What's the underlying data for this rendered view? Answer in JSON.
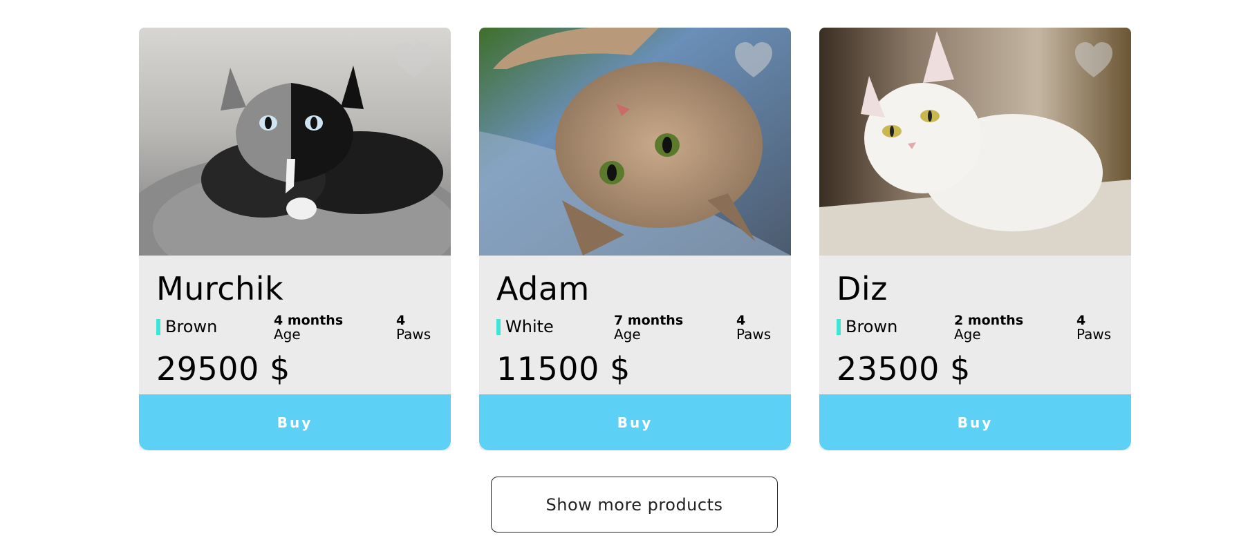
{
  "products": [
    {
      "name": "Murchik",
      "color": "Brown",
      "age_value": "4 months",
      "age_label": "Age",
      "paws_value": "4",
      "paws_label": "Paws",
      "price": "29500 $",
      "buy_label": "Buy",
      "photo": "cat-photo-gray-black-split-face"
    },
    {
      "name": "Adam",
      "color": "White",
      "age_value": "7 months",
      "age_label": "Age",
      "paws_value": "4",
      "paws_label": "Paws",
      "price": "11500 $",
      "buy_label": "Buy",
      "photo": "cat-photo-tabby-lying-upside-down"
    },
    {
      "name": "Diz",
      "color": "Brown",
      "age_value": "2 months",
      "age_label": "Age",
      "paws_value": "4",
      "paws_label": "Paws",
      "price": "23500 $",
      "buy_label": "Buy",
      "photo": "cat-photo-white-sitting"
    }
  ],
  "show_more_label": "Show more products",
  "icons": {
    "favorite": "heart-icon"
  },
  "colors": {
    "buy_button": "#5dd0f5",
    "color_marker": "#3fe4d8",
    "card_background": "#ebebeb"
  }
}
